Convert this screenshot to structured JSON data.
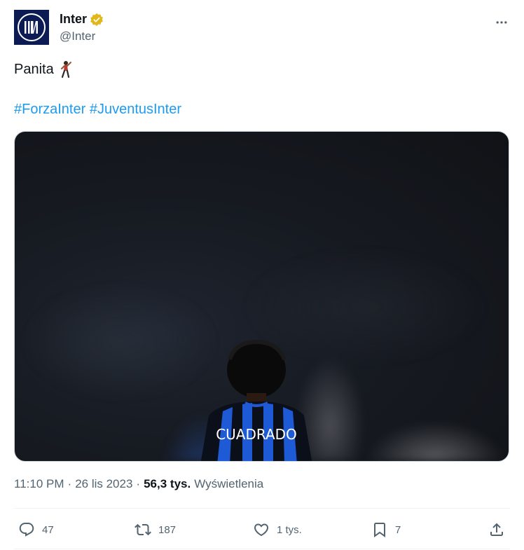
{
  "author": {
    "display_name": "Inter",
    "handle": "@Inter",
    "verified_badge_color": "#e2b719",
    "avatar_bg": "#0d1b54"
  },
  "tweet": {
    "text": "Panita",
    "emoji": "person-dancing-emoji",
    "hashtags": [
      "#ForzaInter",
      "#JuventusInter"
    ],
    "media": {
      "jersey_name": "CUADRADO"
    }
  },
  "meta": {
    "time": "11:10 PM",
    "dot1": "·",
    "date": "26 lis 2023",
    "dot2": "·",
    "views_count": "56,3 tys.",
    "views_label": "Wyświetlenia"
  },
  "actions": {
    "reply_count": "47",
    "retweet_count": "187",
    "like_count": "1 tys.",
    "bookmark_count": "7"
  },
  "colors": {
    "link": "#1d9bf0",
    "secondary_text": "#536471",
    "primary_text": "#0f1419"
  }
}
